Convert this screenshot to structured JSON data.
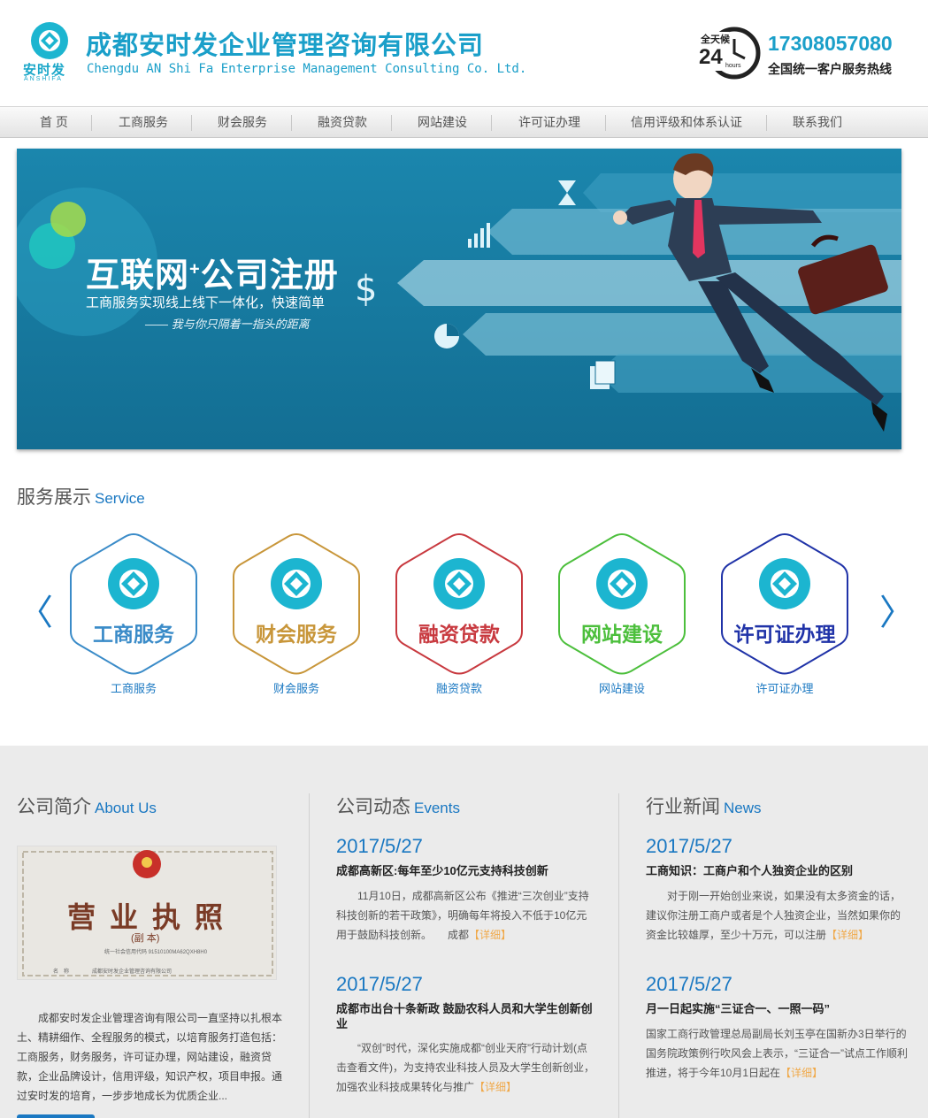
{
  "header": {
    "logo_text": "安时发",
    "logo_sub": "ANSHIFA",
    "company_cn": "成都安时发企业管理咨询有限公司",
    "company_en": "Chengdu AN Shi Fa Enterprise Management Consulting Co. Ltd.",
    "badge_top": "全天候",
    "badge_num": "24",
    "badge_unit": "hours",
    "hotline_number": "17308057080",
    "hotline_label": "全国统一客户服务热线"
  },
  "nav": [
    "首 页",
    "工商服务",
    "财会服务",
    "融资贷款",
    "网站建设",
    "许可证办理",
    "信用评级和体系认证",
    "联系我们"
  ],
  "banner": {
    "title_a": "互联网",
    "title_plus": "+",
    "title_b": "公司注册",
    "subtitle": "工商服务实现线上线下一体化，快速简单",
    "sign": "—— 我与你只隔着一指头的距离"
  },
  "services": {
    "title": "服务展示",
    "title_en": "Service",
    "prev_icon": "chevron-left-icon",
    "next_icon": "chevron-right-icon",
    "items": [
      {
        "label": "工商服务",
        "caption": "工商服务",
        "color": "#3a8bc8"
      },
      {
        "label": "财会服务",
        "caption": "财会服务",
        "color": "#c8963a"
      },
      {
        "label": "融资贷款",
        "caption": "融资贷款",
        "color": "#c8393f"
      },
      {
        "label": "网站建设",
        "caption": "网站建设",
        "color": "#4cbf3c"
      },
      {
        "label": "许可证办理",
        "caption": "许可证办理",
        "color": "#2033a8"
      }
    ]
  },
  "about": {
    "title": "公司简介",
    "title_en": "About Us",
    "cert_title": "营业执照",
    "cert_copy": "(副 本)",
    "cert_code": "统一社会信用代码 91510100MA62QXH8H0",
    "cert_name_label": "名　称",
    "cert_name": "成都安时发企业管理咨询有限公司",
    "text": "成都安时发企业管理咨询有限公司一直坚持以扎根本土、精耕细作、全程服务的模式，以培育服务打造包括：工商服务，财务服务，许可证办理，网站建设，融资贷款，企业品牌设计，信用评级，知识产权，项目申报。通过安时发的培育，一步步地成长为优质企业..."
  },
  "events": {
    "title": "公司动态",
    "title_en": "Events",
    "items": [
      {
        "date": "2017/5/27",
        "headline": "成都高新区:每年至少10亿元支持科技创新",
        "body": "11月10日，成都高新区公布《推进“三次创业”支持科技创新的若干政策》，明确每年将投入不低于10亿元用于鼓励科技创新。　　成都",
        "more": "【详细】"
      },
      {
        "date": "2017/5/27",
        "headline": "成都市出台十条新政 鼓励农科人员和大学生创新创业",
        "body": "“双创”时代，深化实施成都“创业天府”行动计划(点击查看文件)，为支持农业科技人员及大学生创新创业，加强农业科技成果转化与推广",
        "more": "【详细】"
      }
    ]
  },
  "news": {
    "title": "行业新闻",
    "title_en": "News",
    "items": [
      {
        "date": "2017/5/27",
        "headline": "工商知识：工商户和个人独资企业的区别",
        "body": "对于刚一开始创业来说，如果没有太多资金的话，建议你注册工商户或者是个人独资企业，当然如果你的资金比较雄厚，至少十万元，可以注册",
        "more": "【详细】"
      },
      {
        "date": "2017/5/27",
        "headline": "月一日起实施“三证合一、一照一码”",
        "body": "国家工商行政管理总局副局长刘玉亭在国新办3日举行的国务院政策例行吹风会上表示，“三证合一”试点工作顺利推进，将于今年10月1日起在",
        "more": "【详细】"
      }
    ]
  }
}
